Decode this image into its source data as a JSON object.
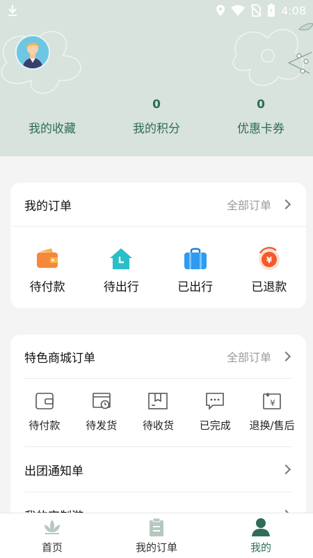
{
  "status_bar": {
    "time": "4:08",
    "icons": [
      "download-icon",
      "location-icon",
      "wifi-icon",
      "no-sim-icon",
      "battery-icon"
    ]
  },
  "profile": {
    "stats": [
      {
        "value": "",
        "label": "我的收藏"
      },
      {
        "value": "0",
        "label": "我的积分"
      },
      {
        "value": "0",
        "label": "优惠卡券"
      }
    ]
  },
  "my_orders": {
    "title": "我的订单",
    "all_link": "全部订单",
    "items": [
      {
        "label": "待付款",
        "icon": "wallet-icon"
      },
      {
        "label": "待出行",
        "icon": "home-clock-icon"
      },
      {
        "label": "已出行",
        "icon": "bag-icon"
      },
      {
        "label": "已退款",
        "icon": "refund-icon"
      }
    ]
  },
  "mall_orders": {
    "title": "特色商城订单",
    "all_link": "全部订单",
    "items": [
      {
        "label": "待付款",
        "icon": "wallet-outline-icon"
      },
      {
        "label": "待发货",
        "icon": "ship-pending-icon"
      },
      {
        "label": "待收货",
        "icon": "box-icon"
      },
      {
        "label": "已完成",
        "icon": "chat-dots-icon"
      },
      {
        "label": "退换/售后",
        "icon": "yen-refund-icon"
      }
    ],
    "rows": [
      {
        "label": "出团通知单"
      },
      {
        "label": "我的定制游"
      }
    ]
  },
  "tabs": [
    {
      "label": "首页",
      "icon": "lotus-icon"
    },
    {
      "label": "我的订单",
      "icon": "clipboard-icon"
    },
    {
      "label": "我的",
      "icon": "person-icon",
      "active": true
    }
  ],
  "colors": {
    "header_bg": "#d7e3dc",
    "accent": "#2f6c59"
  }
}
